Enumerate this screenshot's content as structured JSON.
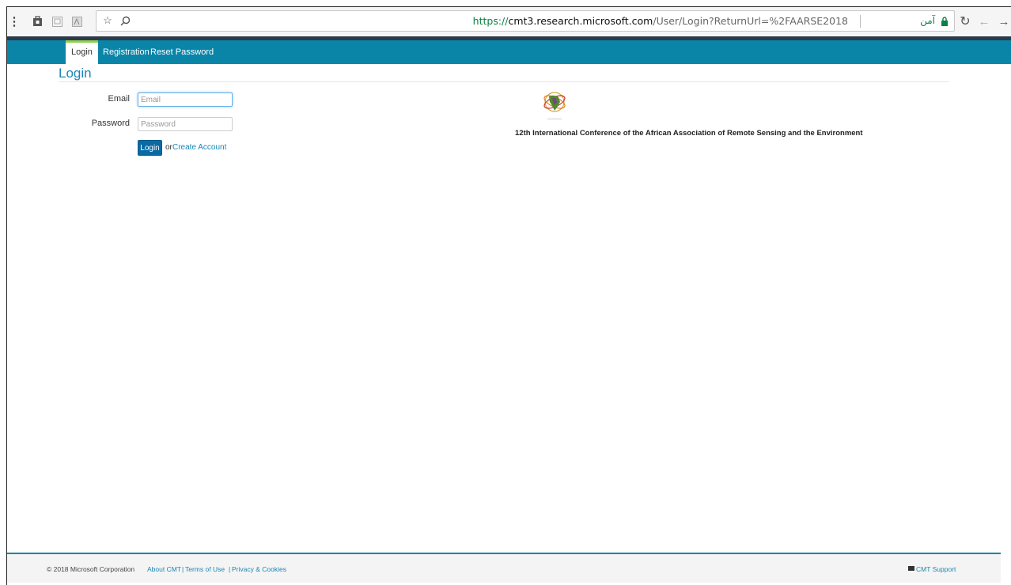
{
  "browser": {
    "url_scheme": "https://",
    "url_host": "cmt3.research.microsoft.com",
    "url_path": "/User/Login?ReturnUrl=%2FAARSE2018",
    "secure_label": "آمن",
    "menu_dots": "⋮",
    "icons": [
      "bag-icon",
      "pocket-icon",
      "pdf-icon",
      "star-icon",
      "search-icon",
      "lock-icon",
      "reload-icon",
      "back-icon",
      "forward-icon"
    ]
  },
  "nav": {
    "login": "Login",
    "registration": "Registration",
    "reset_password": "Reset Password"
  },
  "page": {
    "title": "Login",
    "email_label": "Email",
    "email_placeholder": "Email",
    "password_label": "Password",
    "password_placeholder": "Password",
    "login_button": "Login",
    "or_text": "or",
    "create_account": "Create Account"
  },
  "conference": {
    "name": "12th International Conference of the African Association of Remote Sensing and the Environment"
  },
  "footer": {
    "copyright": "© 2018 Microsoft Corporation",
    "about": "About CMT",
    "terms": "Terms of Use",
    "privacy": "Privacy & Cookies",
    "separator": "|",
    "support": "CMT Support"
  },
  "colors": {
    "nav_bg": "#0a85a8",
    "accent": "#1a87b5",
    "button": "#0a6aa3",
    "secure_green": "#0b8043"
  }
}
